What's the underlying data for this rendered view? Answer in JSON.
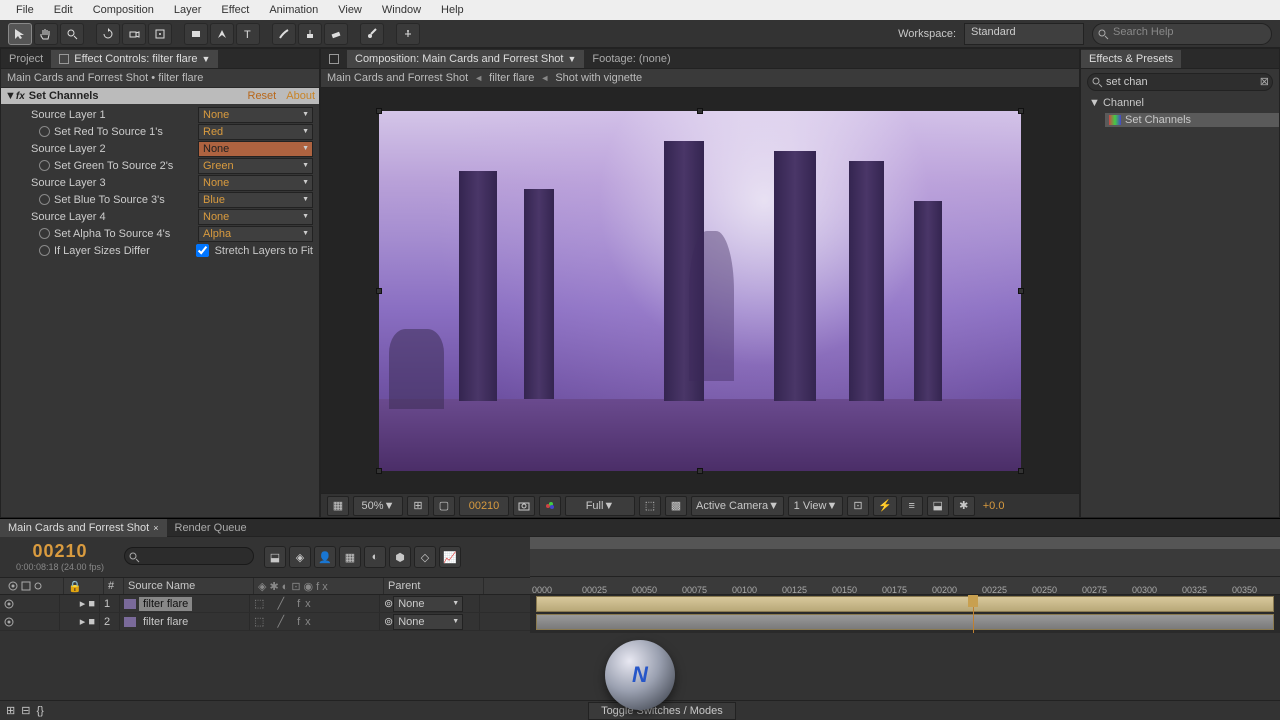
{
  "menu": [
    "File",
    "Edit",
    "Composition",
    "Layer",
    "Effect",
    "Animation",
    "View",
    "Window",
    "Help"
  ],
  "workspace": {
    "label": "Workspace:",
    "value": "Standard"
  },
  "search_help": {
    "placeholder": "Search Help"
  },
  "left_tabs": {
    "project": "Project",
    "effect_controls": "Effect Controls: filter flare"
  },
  "breadcrumb": "Main Cards and Forrest Shot • filter flare",
  "effect": {
    "name": "Set Channels",
    "reset": "Reset",
    "about": "About",
    "rows": [
      {
        "label": "Source Layer 1",
        "value": "None"
      },
      {
        "label": "Set Red To Source 1's",
        "value": "Red",
        "stopwatch": true
      },
      {
        "label": "Source Layer 2",
        "value": "None",
        "highlight": true
      },
      {
        "label": "Set Green To Source 2's",
        "value": "Green",
        "stopwatch": true
      },
      {
        "label": "Source Layer 3",
        "value": "None"
      },
      {
        "label": "Set Blue To Source 3's",
        "value": "Blue",
        "stopwatch": true
      },
      {
        "label": "Source Layer 4",
        "value": "None"
      },
      {
        "label": "Set Alpha To Source 4's",
        "value": "Alpha",
        "stopwatch": true
      }
    ],
    "stretch": {
      "label": "If Layer Sizes Differ",
      "checkbox_label": "Stretch Layers to Fit",
      "checked": true
    }
  },
  "center_tabs": {
    "composition": "Composition: Main Cards and Forrest Shot",
    "footage": "Footage: (none)"
  },
  "comp_breadcrumb": [
    "Main Cards and Forrest Shot",
    "filter flare",
    "Shot with vignette"
  ],
  "viewer_controls": {
    "zoom": "50%",
    "frame": "00210",
    "resolution": "Full",
    "camera": "Active Camera",
    "views": "1 View",
    "exposure": "+0.0"
  },
  "right": {
    "title": "Effects & Presets",
    "search": "set chan",
    "group": "Channel",
    "item": "Set Channels"
  },
  "timeline": {
    "tab_main": "Main Cards and Forrest Shot",
    "tab_render": "Render Queue",
    "current": "00210",
    "fps": "0:00:08:18 (24.00 fps)",
    "col_num": "#",
    "col_source": "Source Name",
    "col_parent": "Parent",
    "parent_value": "None",
    "toggle": "Toggle Switches / Modes",
    "ticks": [
      "0000",
      "00025",
      "00050",
      "00075",
      "00100",
      "00125",
      "00150",
      "00175",
      "00200",
      "00225",
      "00250",
      "00275",
      "00300",
      "00325",
      "00350"
    ],
    "layers": [
      {
        "num": "1",
        "name": "filter flare",
        "selected": true
      },
      {
        "num": "2",
        "name": "filter flare",
        "selected": false
      }
    ]
  }
}
